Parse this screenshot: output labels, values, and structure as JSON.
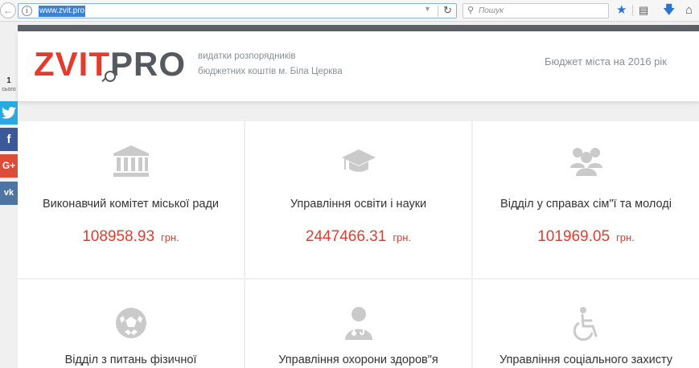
{
  "browser": {
    "url": "www.zvit.pro",
    "search_placeholder": "Пошук"
  },
  "header": {
    "logo_part1": "ZVIT",
    "logo_part2": "PRO",
    "tagline_line1": "видатки розпорядників",
    "tagline_line2": "бюджетних коштів м. Біла Церква",
    "budget_title": "Бюджет міста на 2016 рік"
  },
  "social": {
    "share_count": "1",
    "share_label": "сього",
    "networks": [
      "twitter",
      "facebook",
      "google-plus",
      "vk"
    ]
  },
  "categories": [
    {
      "title": "Виконавчий комітет міської ради",
      "amount": "108958.93",
      "currency": "грн.",
      "icon": "institution-icon"
    },
    {
      "title": "Управління освіти і науки",
      "amount": "2447466.31",
      "currency": "грн.",
      "icon": "graduation-cap-icon"
    },
    {
      "title": "Відділ у справах сім\"ї та молоді",
      "amount": "101969.05",
      "currency": "грн.",
      "icon": "users-icon"
    },
    {
      "title": "Відділ з питань фізичної",
      "icon": "soccer-ball-icon"
    },
    {
      "title": "Управління охорони здоров\"я",
      "icon": "doctor-icon"
    },
    {
      "title": "Управління соціального захисту",
      "icon": "wheelchair-icon"
    }
  ],
  "colors": {
    "brand_red": "#e53b2c",
    "brand_gray": "#555a60",
    "icon_gray": "#cacaca"
  }
}
